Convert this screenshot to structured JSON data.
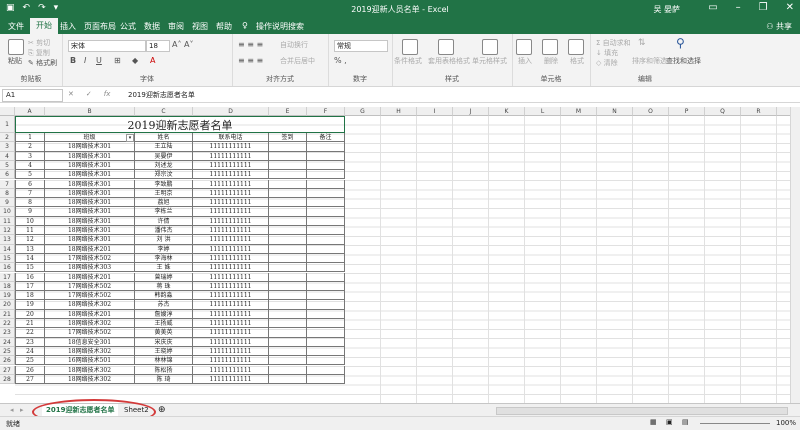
{
  "window": {
    "title": "2019迎新人员名单 - Excel",
    "user": "吴 晏萨"
  },
  "tabs": [
    "文件",
    "开始",
    "插入",
    "页面布局",
    "公式",
    "数据",
    "审阅",
    "视图",
    "帮助"
  ],
  "tell_me": "操作说明搜索",
  "share": "共享",
  "ribbon": {
    "clipboard": {
      "paste": "粘贴",
      "cut": "剪切",
      "copy": "复制",
      "format_painter": "格式刷",
      "label": "剪贴板"
    },
    "font": {
      "name": "宋体",
      "size": "18",
      "label": "字体"
    },
    "alignment": {
      "wrap": "自动换行",
      "merge": "合并后居中",
      "label": "对齐方式"
    },
    "number": {
      "format": "常规",
      "label": "数字"
    },
    "styles": {
      "conditional": "条件格式",
      "as_table": "套用表格格式",
      "cell_styles": "单元格样式",
      "label": "样式"
    },
    "cells": {
      "insert": "插入",
      "delete": "删除",
      "format": "格式",
      "label": "单元格"
    },
    "editing": {
      "autosum": "自动求和",
      "fill": "填充",
      "clear": "清除",
      "sort": "排序和筛选",
      "find": "查找和选择",
      "label": "编辑"
    }
  },
  "formula_bar": {
    "name_box": "A1",
    "content": "2019迎新志愿者名单"
  },
  "columns": [
    "A",
    "B",
    "C",
    "D",
    "E",
    "F",
    "G",
    "H",
    "I",
    "J",
    "K",
    "L",
    "M",
    "N",
    "O",
    "P",
    "Q",
    "R",
    "S",
    "T"
  ],
  "sheet": {
    "title": "2019迎新志愿者名单",
    "headers": [
      "1",
      "班级",
      "姓名",
      "联系电话",
      "签到",
      "备注"
    ],
    "rows": [
      [
        "2",
        "18网络技术301",
        "王立陆",
        "11111111111"
      ],
      [
        "3",
        "18网络技术301",
        "吴晏伊",
        "11111111111"
      ],
      [
        "4",
        "18网络技术301",
        "刘述龙",
        "11111111111"
      ],
      [
        "5",
        "18网络技术301",
        "郑宗汶",
        "11111111111"
      ],
      [
        "6",
        "18网络技术301",
        "李致鹏",
        "11111111111"
      ],
      [
        "7",
        "18网络技术301",
        "王明京",
        "11111111111"
      ],
      [
        "8",
        "18网络技术301",
        "荔旭",
        "11111111111"
      ],
      [
        "9",
        "18网络技术301",
        "李栋兰",
        "11111111111"
      ],
      [
        "10",
        "18网络技术301",
        "许倩",
        "11111111111"
      ],
      [
        "11",
        "18网络技术301",
        "潘伟杰",
        "11111111111"
      ],
      [
        "12",
        "18网络技术301",
        "刘  洪",
        "11111111111"
      ],
      [
        "13",
        "18网络技术201",
        "李婷",
        "11111111111"
      ],
      [
        "14",
        "17网络技术502",
        "李海林",
        "11111111111"
      ],
      [
        "15",
        "18网络技术303",
        "王  姝",
        "11111111111"
      ],
      [
        "16",
        "18网络技术201",
        "曾瑞婷",
        "11111111111"
      ],
      [
        "17",
        "17网络技术502",
        "蒋  珠",
        "11111111111"
      ],
      [
        "18",
        "17网络技术502",
        "韩韵淼",
        "11111111111"
      ],
      [
        "19",
        "18网络技术302",
        "苏杰",
        "11111111111"
      ],
      [
        "20",
        "18网络技术201",
        "詹嫂淳",
        "11111111111"
      ],
      [
        "21",
        "18网络技术302",
        "王扬威",
        "11111111111"
      ],
      [
        "22",
        "17网络技术502",
        "黄美英",
        "11111111111"
      ],
      [
        "23",
        "18信息安全301",
        "宋庆庆",
        "11111111111"
      ],
      [
        "24",
        "18网络技术302",
        "王晓婷",
        "11111111111"
      ],
      [
        "25",
        "16网络技术501",
        "林林锦",
        "11111111111"
      ],
      [
        "26",
        "18网络技术302",
        "陈松扬",
        "11111111111"
      ],
      [
        "27",
        "18网络技术302",
        "陈  琦",
        "11111111111"
      ]
    ]
  },
  "row_numbers": [
    "1",
    "2",
    "3",
    "4",
    "5",
    "6",
    "7",
    "8",
    "9",
    "10",
    "11",
    "12",
    "13",
    "14",
    "15",
    "16",
    "17",
    "18",
    "19",
    "20",
    "21",
    "22",
    "23",
    "24",
    "25",
    "26",
    "27",
    "28"
  ],
  "sheet_tabs": [
    "2019迎新志愿者名单",
    "Sheet2"
  ],
  "status": {
    "ready": "就绪",
    "zoom": "100%"
  },
  "colors": {
    "accent": "#217346",
    "annotation": "#d33a3a"
  }
}
